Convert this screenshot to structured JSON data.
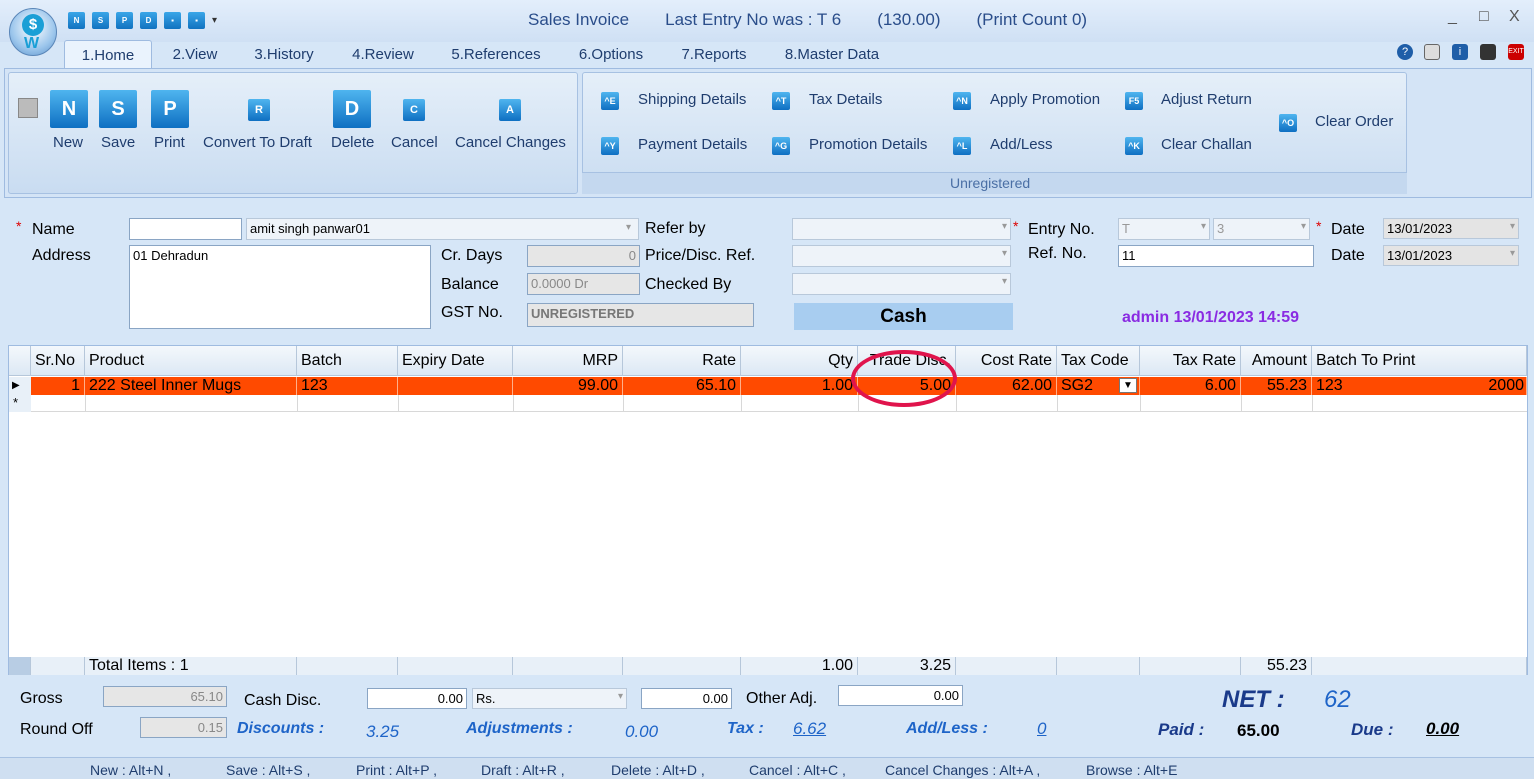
{
  "window": {
    "title": "Sales Invoice",
    "last_entry": "Last Entry No was : T 6",
    "amount": "(130.00)",
    "print_count": "(Print Count 0)",
    "minimize": "_",
    "maximize": "□",
    "close": "X"
  },
  "quick_access": [
    "N",
    "S",
    "P",
    "D",
    "▪",
    "▪"
  ],
  "tabs": [
    "1.Home",
    "2.View",
    "3.History",
    "4.Review",
    "5.References",
    "6.Options",
    "7.Reports",
    "8.Master Data"
  ],
  "ribbon": {
    "main": [
      {
        "label": "New",
        "icon": "N"
      },
      {
        "label": "Save",
        "icon": "S"
      },
      {
        "label": "Print",
        "icon": "P"
      },
      {
        "label": "Convert To Draft",
        "icon": "R"
      },
      {
        "label": "Delete",
        "icon": "D"
      },
      {
        "label": "Cancel",
        "icon": "C"
      },
      {
        "label": "Cancel Changes",
        "icon": "A"
      }
    ],
    "details": [
      {
        "label": "Shipping Details",
        "icon": "^E"
      },
      {
        "label": "Payment Details",
        "icon": "^Y"
      },
      {
        "label": "Tax Details",
        "icon": "^T"
      },
      {
        "label": "Promotion Details",
        "icon": "^G"
      },
      {
        "label": "Apply Promotion",
        "icon": "^N"
      },
      {
        "label": "Add/Less",
        "icon": "^L"
      },
      {
        "label": "Adjust Return",
        "icon": "F5"
      },
      {
        "label": "Clear Challan",
        "icon": "^K"
      },
      {
        "label": "Clear Order",
        "icon": "^O"
      }
    ],
    "group_caption": "Unregistered"
  },
  "form": {
    "name_label": "Name",
    "name_code": "",
    "name_value": "amit singh panwar01",
    "address_label": "Address",
    "address_value": "01 Dehradun",
    "cr_days_label": "Cr. Days",
    "cr_days_value": "0",
    "balance_label": "Balance",
    "balance_value": "0.0000 Dr",
    "gst_label": "GST No.",
    "gst_value": "UNREGISTERED",
    "refer_by_label": "Refer by",
    "price_ref_label": "Price/Disc. Ref.",
    "checked_by_label": "Checked By",
    "cash_label": "Cash",
    "entry_no_label": "Entry No.",
    "entry_series": "T",
    "entry_number": "3",
    "ref_no_label": "Ref. No.",
    "ref_no_value": "11",
    "date_label": "Date",
    "date_value": "13/01/2023",
    "date2_label": "Date",
    "date2_value": "13/01/2023",
    "user_stamp": "admin 13/01/2023 14:59"
  },
  "grid": {
    "columns": [
      "Sr.No",
      "Product",
      "Batch",
      "Expiry Date",
      "MRP",
      "Rate",
      "Qty",
      "Trade Disc.",
      "Cost Rate",
      "Tax Code",
      "Tax Rate",
      "Amount",
      "Batch To Print"
    ],
    "rows": [
      [
        "1",
        "222 Steel Inner Mugs",
        "123",
        "",
        "99.00",
        "65.10",
        "1.00",
        "5.00",
        "62.00",
        "SG2",
        "6.00",
        "55.23",
        "123"
      ]
    ],
    "overflow_value": "2000",
    "totals": {
      "label": "Total Items : 1",
      "qty": "1.00",
      "trade_disc": "3.25",
      "amount": "55.23"
    }
  },
  "footer": {
    "gross_label": "Gross",
    "gross_value": "65.10",
    "round_off_label": "Round Off",
    "round_off_value": "0.15",
    "cash_disc_label": "Cash Disc.",
    "cash_disc_value": "0.00",
    "cash_disc_type": "Rs.",
    "cash_disc_amount": "0.00",
    "other_adj_label": "Other Adj.",
    "other_adj_value": "0.00",
    "discounts_label": "Discounts :",
    "discounts_value": "3.25",
    "adjustments_label": "Adjustments :",
    "adjustments_value": "0.00",
    "tax_label": "Tax :",
    "tax_value": "6.62",
    "addless_label": "Add/Less :",
    "addless_value": "0",
    "net_label": "NET :",
    "net_value": "62",
    "paid_label": "Paid :",
    "paid_value": "65.00",
    "due_label": "Due :",
    "due_value": "0.00"
  },
  "shortcuts": [
    "New : Alt+N ,",
    "Save : Alt+S ,",
    "Print : Alt+P ,",
    "Draft : Alt+R ,",
    "Delete : Alt+D ,",
    "Cancel : Alt+C ,",
    "Cancel Changes : Alt+A ,",
    "Browse : Alt+E"
  ],
  "colors": {
    "selected_row": "#ff4a00",
    "accent": "#1e64c8",
    "user_stamp": "#8a2be2",
    "highlight_circle": "#e0144c"
  }
}
